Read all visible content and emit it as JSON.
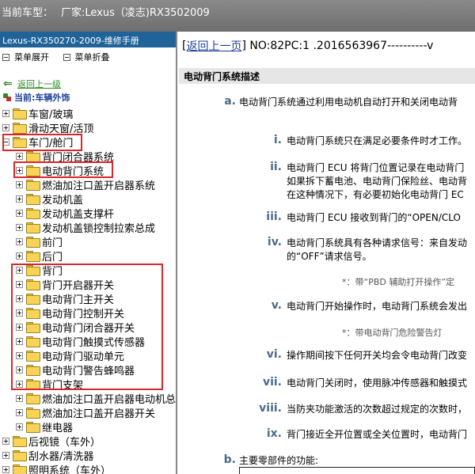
{
  "titlebar": {
    "label": "当前车型：",
    "maker": "厂家:Lexus（凌志)RX3502009"
  },
  "sidebar": {
    "manual_title": "Lexus-RX350270-2009-维修手册",
    "expand_label": "菜单展开",
    "collapse_label": "菜单折叠",
    "back_up_label": "返回上一级",
    "current_label": "当前:车辆外饰",
    "items": [
      {
        "label": "车窗/玻璃",
        "level": 0,
        "expander": "plus"
      },
      {
        "label": "滑动天窗/活顶",
        "level": 0,
        "expander": "plus"
      },
      {
        "label": "车门/舱门",
        "level": 0,
        "expander": "minus"
      },
      {
        "label": "背门闭合器系统",
        "level": 1,
        "expander": "plus"
      },
      {
        "label": "电动背门系统",
        "level": 1,
        "expander": "plus"
      },
      {
        "label": "燃油加注口盖开启器系统",
        "level": 1,
        "expander": "plus"
      },
      {
        "label": "发动机盖",
        "level": 1,
        "expander": "plus"
      },
      {
        "label": "发动机盖支撑杆",
        "level": 1,
        "expander": "plus"
      },
      {
        "label": "发动机盖锁控制拉索总成",
        "level": 1,
        "expander": "plus"
      },
      {
        "label": "前门",
        "level": 1,
        "expander": "plus"
      },
      {
        "label": "后门",
        "level": 1,
        "expander": "plus"
      },
      {
        "label": "背门",
        "level": 1,
        "expander": "plus"
      },
      {
        "label": "背门开启器开关",
        "level": 1,
        "expander": "plus"
      },
      {
        "label": "电动背门主开关",
        "level": 1,
        "expander": "plus"
      },
      {
        "label": "电动背门控制开关",
        "level": 1,
        "expander": "plus"
      },
      {
        "label": "电动背门闭合器开关",
        "level": 1,
        "expander": "plus"
      },
      {
        "label": "电动背门触摸式传感器",
        "level": 1,
        "expander": "plus"
      },
      {
        "label": "电动背门驱动单元",
        "level": 1,
        "expander": "plus"
      },
      {
        "label": "电动背门警告蜂鸣器",
        "level": 1,
        "expander": "plus"
      },
      {
        "label": "背门支架",
        "level": 1,
        "expander": "plus"
      },
      {
        "label": "燃油加注口盖开启器电动机总",
        "level": 1,
        "expander": "plus"
      },
      {
        "label": "燃油加注口盖开启器开关",
        "level": 1,
        "expander": "plus"
      },
      {
        "label": "继电器",
        "level": 1,
        "expander": "plus"
      },
      {
        "label": "后视镜（车外）",
        "level": 0,
        "expander": "plus"
      },
      {
        "label": "刮水器/清洗器",
        "level": 0,
        "expander": "plus"
      },
      {
        "label": "照明系统（车外）",
        "level": 0,
        "expander": "plus"
      }
    ]
  },
  "content": {
    "back_link": "返回上一页",
    "doc_id": "NO:82PC:1 .2016563967----------v",
    "section_title": "电动背门系统描述",
    "items": [
      {
        "marker": "a.",
        "text": "电动背门系统通过利用电动机自动打开和关闭电动背"
      },
      {
        "marker": "i.",
        "text": "电动背门系统只在满足必要条件时才工作。"
      },
      {
        "marker": "ii.",
        "lines": [
          "电动背门 ECU 将背门位置记录在电动背门",
          "如果拆下蓄电池、电动背门保险丝、电动背",
          "在这种情况下，有必要初始化电动背门 EC"
        ]
      },
      {
        "marker": "iii.",
        "text": "电动背门 ECU 接收到背门的“OPEN/CLO"
      },
      {
        "marker": "iv.",
        "lines": [
          "电动背门系统具有各种请求信号：来自发动",
          "的“OFF”请求信号。"
        ]
      },
      {
        "note": "*：带“PBD 辅助打开操作”定"
      },
      {
        "marker": "v.",
        "text": "电动背门开始操作时，电动背门系统会发出"
      },
      {
        "note": "*：带电动背门危险警告灯"
      },
      {
        "marker": "vi.",
        "text": "操作期间按下任何开关均会令电动背门改变"
      },
      {
        "marker": "vii.",
        "text": "电动背门关闭时，使用脉冲传感器和触摸式"
      },
      {
        "marker": "viii.",
        "text": "当防夹功能激活的次数超过规定的次数时，"
      },
      {
        "marker": "ix.",
        "text": "背门接近全开位置或全关位置时，电动背门"
      },
      {
        "marker": "b.",
        "text": "主要零部件的功能:"
      }
    ]
  }
}
